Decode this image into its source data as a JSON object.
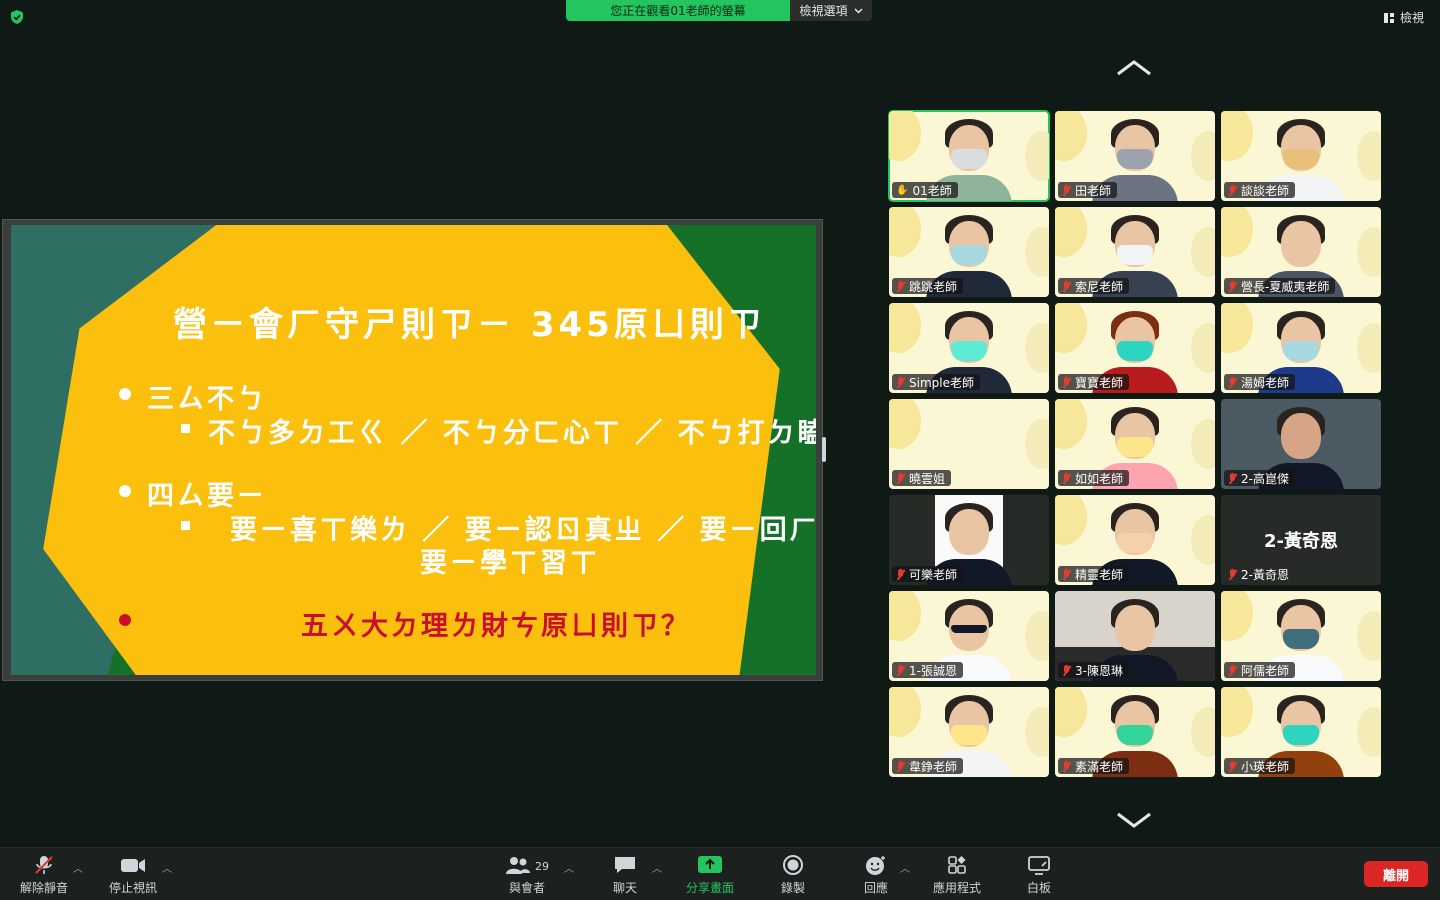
{
  "topbar": {
    "banner_text": "您正在觀看01老師的螢幕",
    "view_options_label": "檢視選項",
    "view_label": "檢視"
  },
  "slide": {
    "title": "營ㄧ會ㄏ守ㄕ則ㄗ－ 345原ㄩ則ㄗ",
    "bullet1": "三ㄙ不ㄅ",
    "bullet1_sub": "不ㄅ多ㄉ工ㄍ ／ 不ㄅ分ㄈ心ㄒ ／ 不ㄅ打ㄉ瞌ㄎ睡ㄕ",
    "bullet2": "四ㄙ要ㄧ",
    "bullet2_sub_line1": "要ㄧ喜ㄒ樂ㄌ ／ 要ㄧ認ㄖ真ㄓ ／ 要ㄧ回ㄏ應ㄧ",
    "bullet2_sub_line2": "要ㄧ學ㄒ習ㄒ",
    "bullet3": "五ㄨ大ㄉ理ㄌ財ㄘ原ㄩ則ㄗ？"
  },
  "participants": [
    {
      "name": "01老師",
      "state": "hand"
    },
    {
      "name": "田老師",
      "state": "muted"
    },
    {
      "name": "談談老師",
      "state": "muted"
    },
    {
      "name": "跳跳老師",
      "state": "muted"
    },
    {
      "name": "索尼老師",
      "state": "muted"
    },
    {
      "name": "營長-夏威夷老師",
      "state": "muted"
    },
    {
      "name": "Simple老師",
      "state": "muted"
    },
    {
      "name": "寶寶老師",
      "state": "muted"
    },
    {
      "name": "湯姆老師",
      "state": "muted"
    },
    {
      "name": "曉雲姐",
      "state": "muted"
    },
    {
      "name": "如如老師",
      "state": "muted"
    },
    {
      "name": "2-高崑傑",
      "state": "muted"
    },
    {
      "name": "可樂老師",
      "state": "muted"
    },
    {
      "name": "精靈老師",
      "state": "muted"
    },
    {
      "name": "2-黃奇恩",
      "state": "muted",
      "video_off": true
    },
    {
      "name": "1-張誠恩",
      "state": "muted"
    },
    {
      "name": "3-陳恩琳",
      "state": "muted"
    },
    {
      "name": "阿儒老師",
      "state": "muted"
    },
    {
      "name": "韋錚老師",
      "state": "muted"
    },
    {
      "name": "素滿老師",
      "state": "muted"
    },
    {
      "name": "小瑛老師",
      "state": "muted"
    }
  ],
  "toolbar": {
    "unmute": "解除靜音",
    "stop_video": "停止視訊",
    "participants": "與會者",
    "participant_count": "29",
    "chat": "聊天",
    "share_screen": "分享畫面",
    "record": "錄製",
    "reactions": "回應",
    "apps": "應用程式",
    "whiteboard": "白板",
    "leave": "離開"
  },
  "colors": {
    "accent_green": "#22c55e",
    "slide_yellow": "#fbbf0e",
    "slide_green": "#157028",
    "slide_teal": "#2f6e62",
    "leave_red": "#dc2626"
  }
}
